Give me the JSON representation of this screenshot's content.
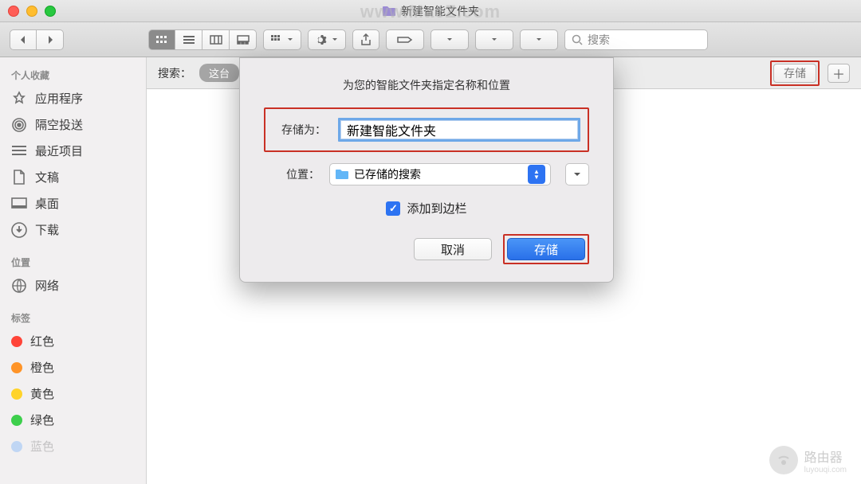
{
  "window": {
    "title": "新建智能文件夹",
    "watermark": "www.MacZ.com"
  },
  "toolbar": {
    "search_placeholder": "搜索"
  },
  "sidebar": {
    "favorites_header": "个人收藏",
    "favorites": [
      {
        "label": "应用程序",
        "icon": "applications"
      },
      {
        "label": "隔空投送",
        "icon": "airdrop"
      },
      {
        "label": "最近项目",
        "icon": "recents"
      },
      {
        "label": "文稿",
        "icon": "documents"
      },
      {
        "label": "桌面",
        "icon": "desktop"
      },
      {
        "label": "下载",
        "icon": "downloads"
      }
    ],
    "locations_header": "位置",
    "locations": [
      {
        "label": "网络",
        "icon": "network"
      }
    ],
    "tags_header": "标签",
    "tags": [
      {
        "label": "红色",
        "color": "#ff4438"
      },
      {
        "label": "橙色",
        "color": "#ff9428"
      },
      {
        "label": "黄色",
        "color": "#ffd32a"
      },
      {
        "label": "绿色",
        "color": "#3dcf4c"
      },
      {
        "label": "蓝色",
        "color": "#2e8cff"
      }
    ]
  },
  "searchbar": {
    "label": "搜索：",
    "scope": "这台",
    "save_button": "存储"
  },
  "dialog": {
    "title": "为您的智能文件夹指定名称和位置",
    "save_as_label": "存储为：",
    "save_as_value": "新建智能文件夹",
    "location_label": "位置：",
    "location_value": "已存储的搜索",
    "add_to_sidebar": "添加到边栏",
    "cancel": "取消",
    "save": "存储"
  },
  "corner": {
    "text": "路由器",
    "sub": "luyouqi.com"
  }
}
